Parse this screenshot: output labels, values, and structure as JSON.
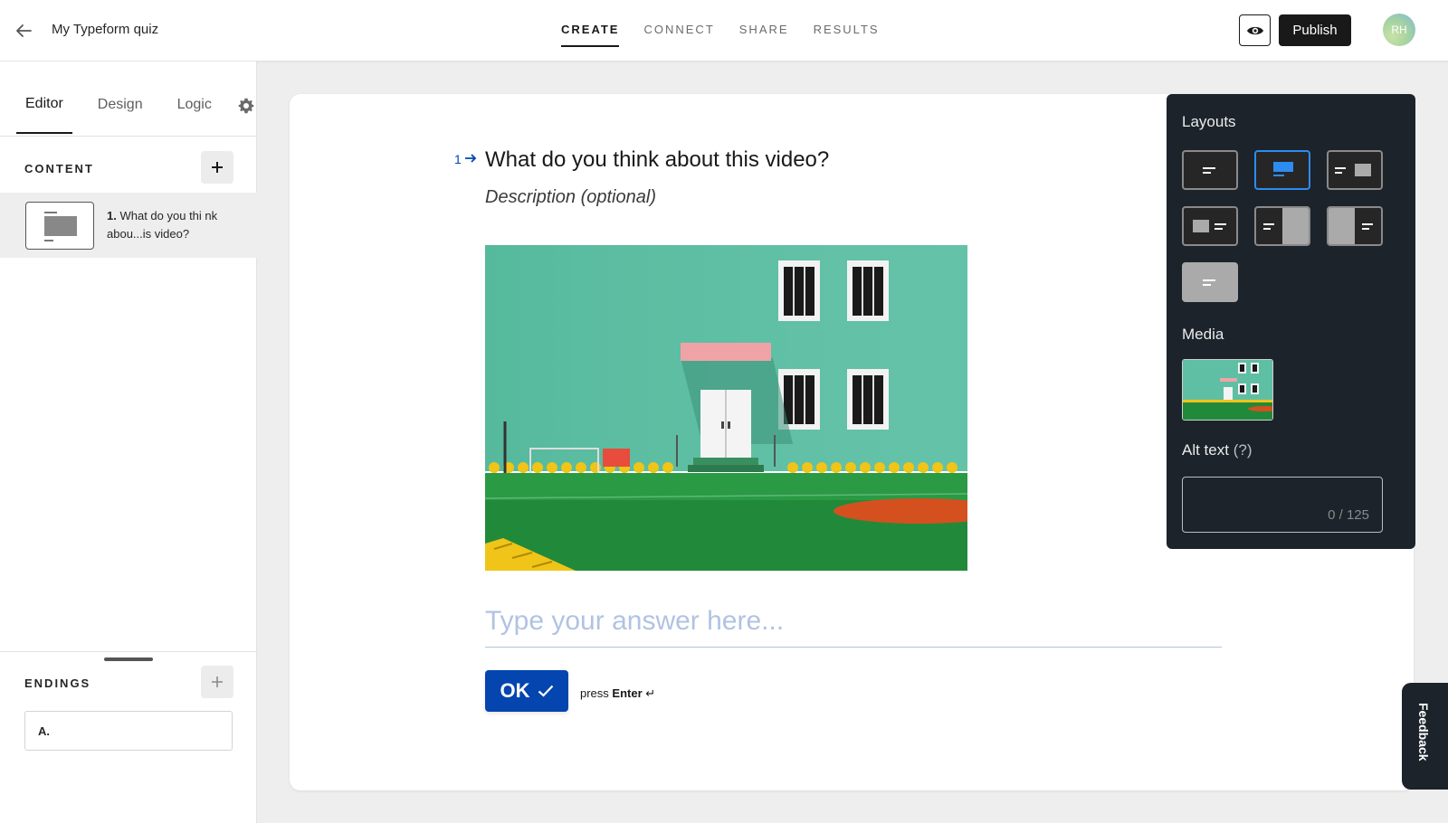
{
  "header": {
    "title": "My Typeform quiz",
    "tabs": [
      {
        "label": "CREATE",
        "active": true
      },
      {
        "label": "CONNECT",
        "active": false
      },
      {
        "label": "SHARE",
        "active": false
      },
      {
        "label": "RESULTS",
        "active": false
      }
    ],
    "publish_label": "Publish",
    "avatar_initials": "RH"
  },
  "sidebar": {
    "tabs": [
      "Editor",
      "Design",
      "Logic"
    ],
    "content_heading": "CONTENT",
    "questions": [
      {
        "number": "1.",
        "text": "What do you thi nk abou...is video?"
      }
    ],
    "endings_heading": "ENDINGS",
    "endings": [
      {
        "label": "A."
      }
    ]
  },
  "question": {
    "number": "1",
    "title": "What do you think about this video?",
    "description": "Description (optional)",
    "answer_placeholder": "Type your answer here...",
    "ok_label": "OK",
    "press_prefix": "press",
    "press_key": "Enter",
    "press_symbol": "↵"
  },
  "panel": {
    "layouts_label": "Layouts",
    "media_label": "Media",
    "alt_text_label": "Alt text",
    "alt_text_help": "(?)",
    "alt_text_count": "0 / 125",
    "selected_layout": 1
  },
  "feedback_label": "Feedback",
  "colors": {
    "accent": "#0445af",
    "panel_bg": "#1c232b",
    "selected_layout_border": "#2d8cf0",
    "wall_green": "#5fbfa4",
    "grass_green": "#218a3a"
  }
}
